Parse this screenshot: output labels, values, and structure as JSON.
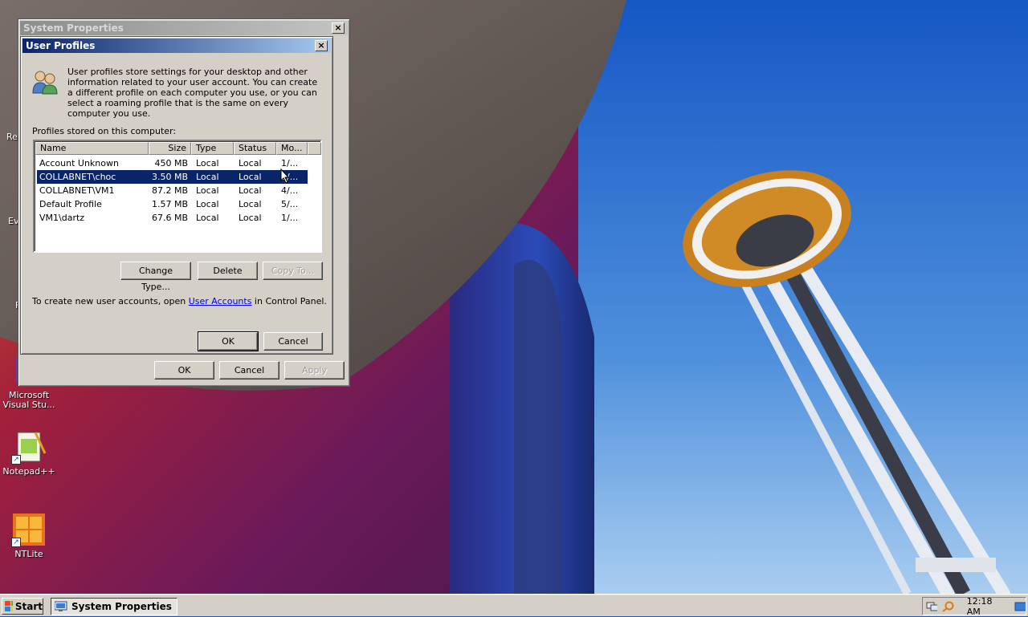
{
  "desktop": {
    "icons": [
      {
        "label": "Microsoft Visual Stu...",
        "icon": "visual-studio-icon"
      },
      {
        "label": "Notepad++",
        "icon": "notepad-plus-plus-icon"
      },
      {
        "label": "NTLite",
        "icon": "ntlite-icon"
      }
    ],
    "partial_labels": [
      "Re",
      "Ev",
      "F"
    ]
  },
  "system_properties": {
    "title": "System Properties",
    "close_label": "×",
    "ok_label": "OK",
    "cancel_label": "Cancel",
    "apply_label": "Apply"
  },
  "user_profiles": {
    "title": "User Profiles",
    "close_label": "×",
    "description": "User profiles store settings for your desktop and other information related to your user account. You can create a different profile on each computer you use, or you can select a roaming profile that is the same on every computer you use.",
    "profiles_label": "Profiles stored on this computer:",
    "columns": [
      "Name",
      "Size",
      "Type",
      "Status",
      "Mo..."
    ],
    "rows": [
      {
        "name": "Account Unknown",
        "size": "450 MB",
        "type": "Local",
        "status": "Local",
        "modified": "1/..."
      },
      {
        "name": "COLLABNET\\choc",
        "size": "3.50 MB",
        "type": "Local",
        "status": "Local",
        "modified": "1/...",
        "selected": true
      },
      {
        "name": "COLLABNET\\VM1",
        "size": "87.2 MB",
        "type": "Local",
        "status": "Local",
        "modified": "4/..."
      },
      {
        "name": "Default Profile",
        "size": "1.57 MB",
        "type": "Local",
        "status": "Local",
        "modified": "5/..."
      },
      {
        "name": "VM1\\dartz",
        "size": "67.6 MB",
        "type": "Local",
        "status": "Local",
        "modified": "1/..."
      }
    ],
    "change_type_label": "Change Type...",
    "delete_label": "Delete",
    "copy_to_label": "Copy To...",
    "create_prefix": "To create new user accounts, open ",
    "create_link": "User Accounts",
    "create_suffix": " in Control Panel.",
    "ok_label": "OK",
    "cancel_label": "Cancel"
  },
  "taskbar": {
    "start_label": "Start",
    "task_label": "System Properties",
    "clock": "12:18 AM"
  },
  "colors": {
    "selection": "#0a246a",
    "active_title_start": "#0a246a",
    "active_title_end": "#a6caf0",
    "face": "#d4d0c8"
  }
}
